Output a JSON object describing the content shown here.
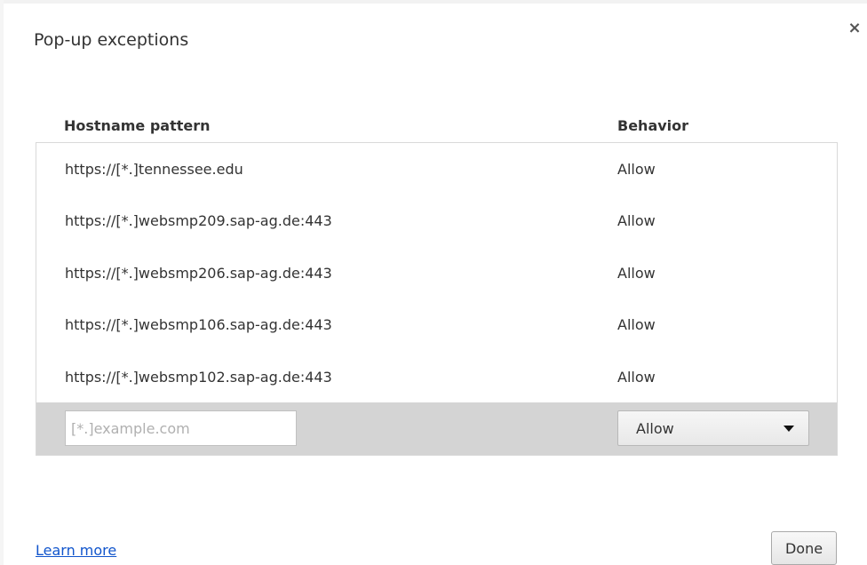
{
  "dialog": {
    "title": "Pop-up exceptions",
    "close_label": "×"
  },
  "table": {
    "headers": {
      "hostname": "Hostname pattern",
      "behavior": "Behavior"
    },
    "rows": [
      {
        "host": "https://[*.]tennessee.edu",
        "behavior": "Allow"
      },
      {
        "host": "https://[*.]websmp209.sap-ag.de:443",
        "behavior": "Allow"
      },
      {
        "host": "https://[*.]websmp206.sap-ag.de:443",
        "behavior": "Allow"
      },
      {
        "host": "https://[*.]websmp106.sap-ag.de:443",
        "behavior": "Allow"
      },
      {
        "host": "https://[*.]websmp102.sap-ag.de:443",
        "behavior": "Allow"
      }
    ],
    "new_entry": {
      "placeholder": "[*.]example.com",
      "value": "",
      "behavior_selected": "Allow"
    }
  },
  "footer": {
    "learn_more": "Learn more",
    "done": "Done"
  },
  "colors": {
    "link": "#1155cc",
    "new_row_bg": "#d4d4d4",
    "border": "#d9d9d9"
  }
}
